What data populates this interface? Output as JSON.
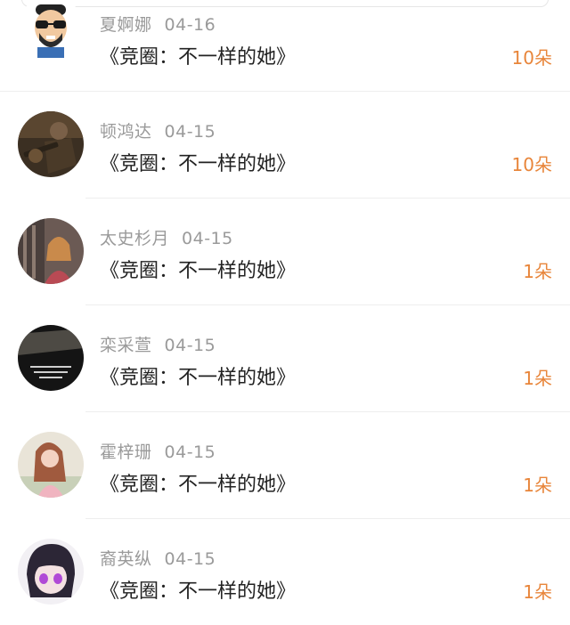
{
  "items": [
    {
      "name": "夏婀娜",
      "date": "04-16",
      "title": "《竞圈：不一样的她》",
      "count": "10朵",
      "avatar": "cartoon-sunglasses-avatar"
    },
    {
      "name": "顿鸿达",
      "date": "04-15",
      "title": "《竞圈：不一样的她》",
      "count": "10朵",
      "avatar": "game-soldier-avatar"
    },
    {
      "name": "太史杉月",
      "date": "04-15",
      "title": "《竞圈：不一样的她》",
      "count": "1朵",
      "avatar": "woman-photo-avatar"
    },
    {
      "name": "栾采萱",
      "date": "04-15",
      "title": "《竞圈：不一样的她》",
      "count": "1朵",
      "avatar": "dark-quote-avatar"
    },
    {
      "name": "霍梓珊",
      "date": "04-15",
      "title": "《竞圈：不一样的她》",
      "count": "1朵",
      "avatar": "pink-girl-avatar"
    },
    {
      "name": "裔英纵",
      "date": "04-15",
      "title": "《竞圈：不一样的她》",
      "count": "1朵",
      "avatar": "anime-girl-avatar"
    }
  ],
  "colors": {
    "count": "#e8853a",
    "meta": "#9a9a9a",
    "title": "#222222",
    "divider": "#eeeeee"
  }
}
